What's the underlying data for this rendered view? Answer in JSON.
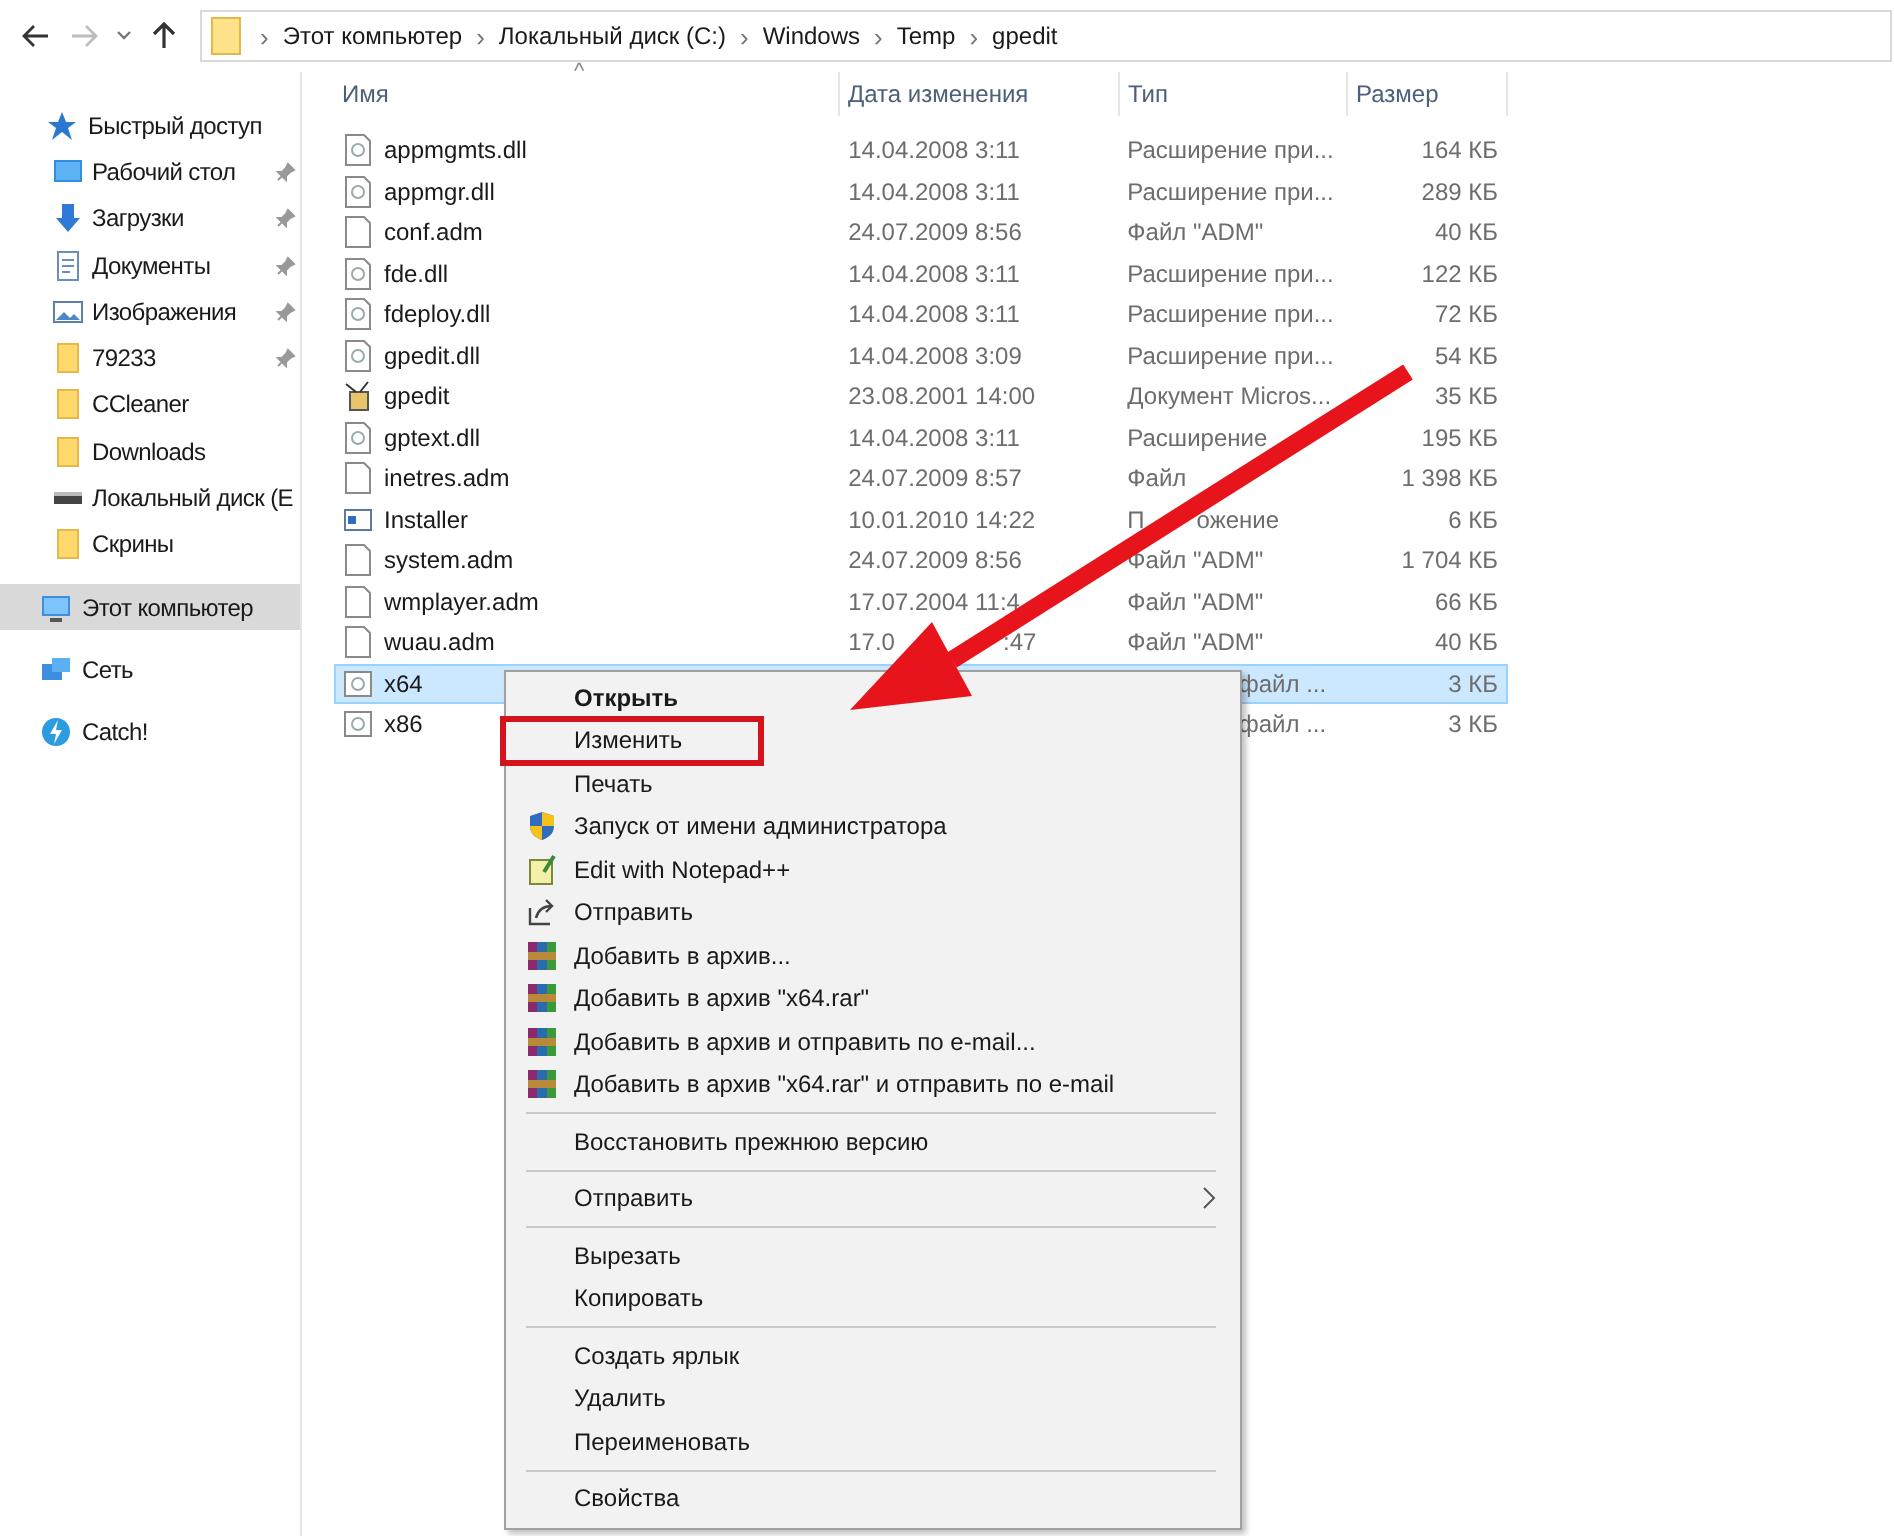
{
  "navigation": {
    "back": {
      "disabled": false
    },
    "forward": {
      "disabled": true
    },
    "recent": {
      "disabled": false
    },
    "up": {
      "disabled": false
    }
  },
  "breadcrumb_separator": "›",
  "breadcrumbs": [
    "Этот компьютер",
    "Локальный диск (C:)",
    "Windows",
    "Temp",
    "gpedit"
  ],
  "sidebar": {
    "items": [
      {
        "label": "Быстрый доступ",
        "kind": "star",
        "selected": false,
        "children": [
          {
            "label": "Рабочий стол",
            "kind": "desktop",
            "pinned": true,
            "selected": false
          },
          {
            "label": "Загрузки",
            "kind": "download",
            "pinned": true,
            "selected": false
          },
          {
            "label": "Документы",
            "kind": "document",
            "pinned": true,
            "selected": false
          },
          {
            "label": "Изображения",
            "kind": "image",
            "pinned": true,
            "selected": false
          },
          {
            "label": "79233",
            "kind": "folder",
            "pinned": true,
            "selected": false
          },
          {
            "label": "CCleaner",
            "kind": "folder",
            "pinned": false,
            "selected": false
          },
          {
            "label": "Downloads",
            "kind": "folder",
            "pinned": false,
            "selected": false
          },
          {
            "label": "Локальный диск (E",
            "kind": "drive",
            "pinned": false,
            "selected": false
          },
          {
            "label": "Скрины",
            "kind": "folder",
            "pinned": false,
            "selected": false
          }
        ]
      },
      {
        "label": "Этот компьютер",
        "kind": "computer",
        "selected": true
      },
      {
        "label": "Сеть",
        "kind": "network",
        "selected": false
      },
      {
        "label": "Catch!",
        "kind": "app",
        "selected": false
      }
    ]
  },
  "table": {
    "sort_indicator": "^",
    "columns": [
      "Имя",
      "Дата изменения",
      "Тип",
      "Размер"
    ],
    "rows": [
      {
        "name": "appmgmts.dll",
        "kind": "dll",
        "date": "14.04.2008 3:11",
        "type": "Расширение при...",
        "size": "164 КБ",
        "selected": false
      },
      {
        "name": "appmgr.dll",
        "kind": "dll",
        "date": "14.04.2008 3:11",
        "type": "Расширение при...",
        "size": "289 КБ",
        "selected": false
      },
      {
        "name": "conf.adm",
        "kind": "file",
        "date": "24.07.2009 8:56",
        "type": "Файл \"ADM\"",
        "size": "40 КБ",
        "selected": false
      },
      {
        "name": "fde.dll",
        "kind": "dll",
        "date": "14.04.2008 3:11",
        "type": "Расширение при...",
        "size": "122 КБ",
        "selected": false
      },
      {
        "name": "fdeploy.dll",
        "kind": "dll",
        "date": "14.04.2008 3:11",
        "type": "Расширение при...",
        "size": "72 КБ",
        "selected": false
      },
      {
        "name": "gpedit.dll",
        "kind": "dll",
        "date": "14.04.2008 3:09",
        "type": "Расширение при...",
        "size": "54 КБ",
        "selected": false
      },
      {
        "name": "gpedit",
        "kind": "package",
        "date": "23.08.2001 14:00",
        "type": "Документ Micros...",
        "size": "35 КБ",
        "selected": false
      },
      {
        "name": "gptext.dll",
        "kind": "dll",
        "date": "14.04.2008 3:11",
        "type": "Расширение",
        "size": "195 КБ",
        "selected": false
      },
      {
        "name": "inetres.adm",
        "kind": "file",
        "date": "24.07.2009 8:57",
        "type": "Файл",
        "size": "1 398 КБ",
        "selected": false
      },
      {
        "name": "Installer",
        "kind": "app",
        "date": "10.01.2010 14:22",
        "type": [
          "П",
          "ожение"
        ],
        "size": "6 КБ",
        "selected": false
      },
      {
        "name": "system.adm",
        "kind": "file",
        "date": "24.07.2009 8:56",
        "type": "Файл \"ADM\"",
        "size": "1 704 КБ",
        "selected": false
      },
      {
        "name": "wmplayer.adm",
        "kind": "file",
        "date": "17.07.2004 11:4",
        "type": "Файл \"ADM\"",
        "size": "66 КБ",
        "selected": false
      },
      {
        "name": "wuau.adm",
        "kind": "file",
        "date": [
          "17.0",
          ":47"
        ],
        "type": "Файл \"ADM\"",
        "size": "40 КБ",
        "selected": false
      },
      {
        "name": "x64",
        "kind": "config",
        "type": "файл ...",
        "size": "3 КБ",
        "selected": true
      },
      {
        "name": "x86",
        "kind": "config",
        "type": "файл ...",
        "size": "3 КБ",
        "selected": false
      }
    ]
  },
  "context_menu": {
    "items": [
      {
        "kind": "plain",
        "label": "Открыть",
        "default": true,
        "highlighted": false
      },
      {
        "kind": "plain",
        "label": "Изменить",
        "default": false,
        "highlighted": true
      },
      {
        "kind": "plain",
        "label": "Печать",
        "default": false,
        "highlighted": false
      },
      {
        "kind": "admin",
        "label": "Запуск от имени администратора",
        "default": false,
        "highlighted": false
      },
      {
        "kind": "editor",
        "label": "Edit with Notepad++",
        "default": false,
        "highlighted": false
      },
      {
        "kind": "share",
        "label": "Отправить",
        "default": false,
        "highlighted": false
      },
      {
        "kind": "archive",
        "label": "Добавить в архив...",
        "default": false,
        "highlighted": false
      },
      {
        "kind": "archive",
        "label": "Добавить в архив \"x64.rar\"",
        "default": false,
        "highlighted": false
      },
      {
        "kind": "archive",
        "label": "Добавить в архив и отправить по e-mail...",
        "default": false,
        "highlighted": false
      },
      {
        "kind": "archive",
        "label": "Добавить в архив \"x64.rar\" и отправить по e-mail",
        "default": false,
        "highlighted": false
      },
      {
        "kind": "separator"
      },
      {
        "kind": "plain",
        "label": "Восстановить прежнюю версию",
        "default": false,
        "highlighted": false
      },
      {
        "kind": "separator"
      },
      {
        "kind": "submenu",
        "label": "Отправить",
        "default": false,
        "highlighted": false
      },
      {
        "kind": "separator"
      },
      {
        "kind": "plain",
        "label": "Вырезать",
        "default": false,
        "highlighted": false
      },
      {
        "kind": "plain",
        "label": "Копировать",
        "default": false,
        "highlighted": false
      },
      {
        "kind": "separator"
      },
      {
        "kind": "plain",
        "label": "Создать ярлык",
        "default": false,
        "highlighted": false
      },
      {
        "kind": "plain",
        "label": "Удалить",
        "default": false,
        "highlighted": false
      },
      {
        "kind": "plain",
        "label": "Переименовать",
        "default": false,
        "highlighted": false
      },
      {
        "kind": "separator"
      },
      {
        "kind": "plain",
        "label": "Свойства",
        "default": false,
        "highlighted": false
      }
    ]
  }
}
